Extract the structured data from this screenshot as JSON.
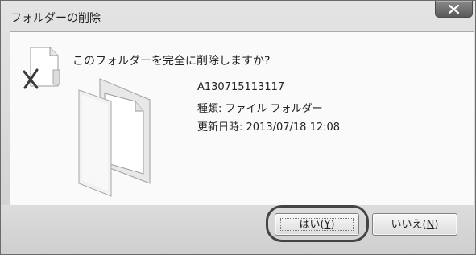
{
  "dialog": {
    "title": "フォルダーの削除",
    "question": "このフォルダーを完全に削除しますか?",
    "item": {
      "name": "A130715113117",
      "type_line": "種類: ファイル フォルダー",
      "modified_line": "更新日時: 2013/07/18 12:08"
    },
    "buttons": {
      "yes_prefix": "はい(",
      "yes_key": "Y",
      "yes_suffix": ")",
      "no_prefix": "いいえ(",
      "no_key": "N",
      "no_suffix": ")"
    }
  },
  "icons": {
    "close": "close-icon",
    "small_doc": "document-cross-icon",
    "large_folder": "open-folder-icon"
  },
  "colors": {
    "close_button": "#6e6e6e",
    "highlight_ring": "#444444"
  }
}
